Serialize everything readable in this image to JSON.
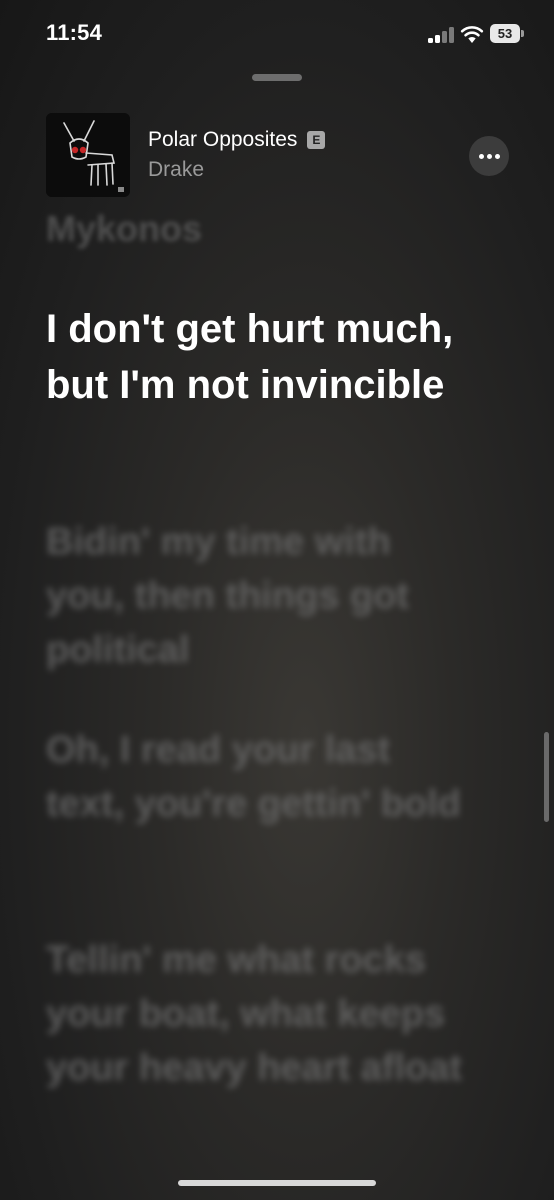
{
  "status_bar": {
    "time": "11:54",
    "battery_level": "53",
    "signal_bars_active": 2,
    "signal_bars_total": 4
  },
  "now_playing": {
    "title": "Polar Opposites",
    "explicit_badge": "E",
    "artist": "Drake",
    "more_icon": "ellipsis-icon"
  },
  "lyrics": {
    "previous": "Mykonos",
    "current": "I don't get hurt much, but I'm not invincible",
    "upcoming": [
      "Bidin' my time with you, then things got political",
      "Oh, I read your last text, you're gettin' bold",
      "Tellin' me what rocks your boat, what keeps your heavy heart afloat"
    ]
  },
  "colors": {
    "background": "#1f1f1f",
    "current_lyric": "#ffffff",
    "dim_lyric": "#6e6e6e",
    "artist": "#9a9a9a"
  }
}
